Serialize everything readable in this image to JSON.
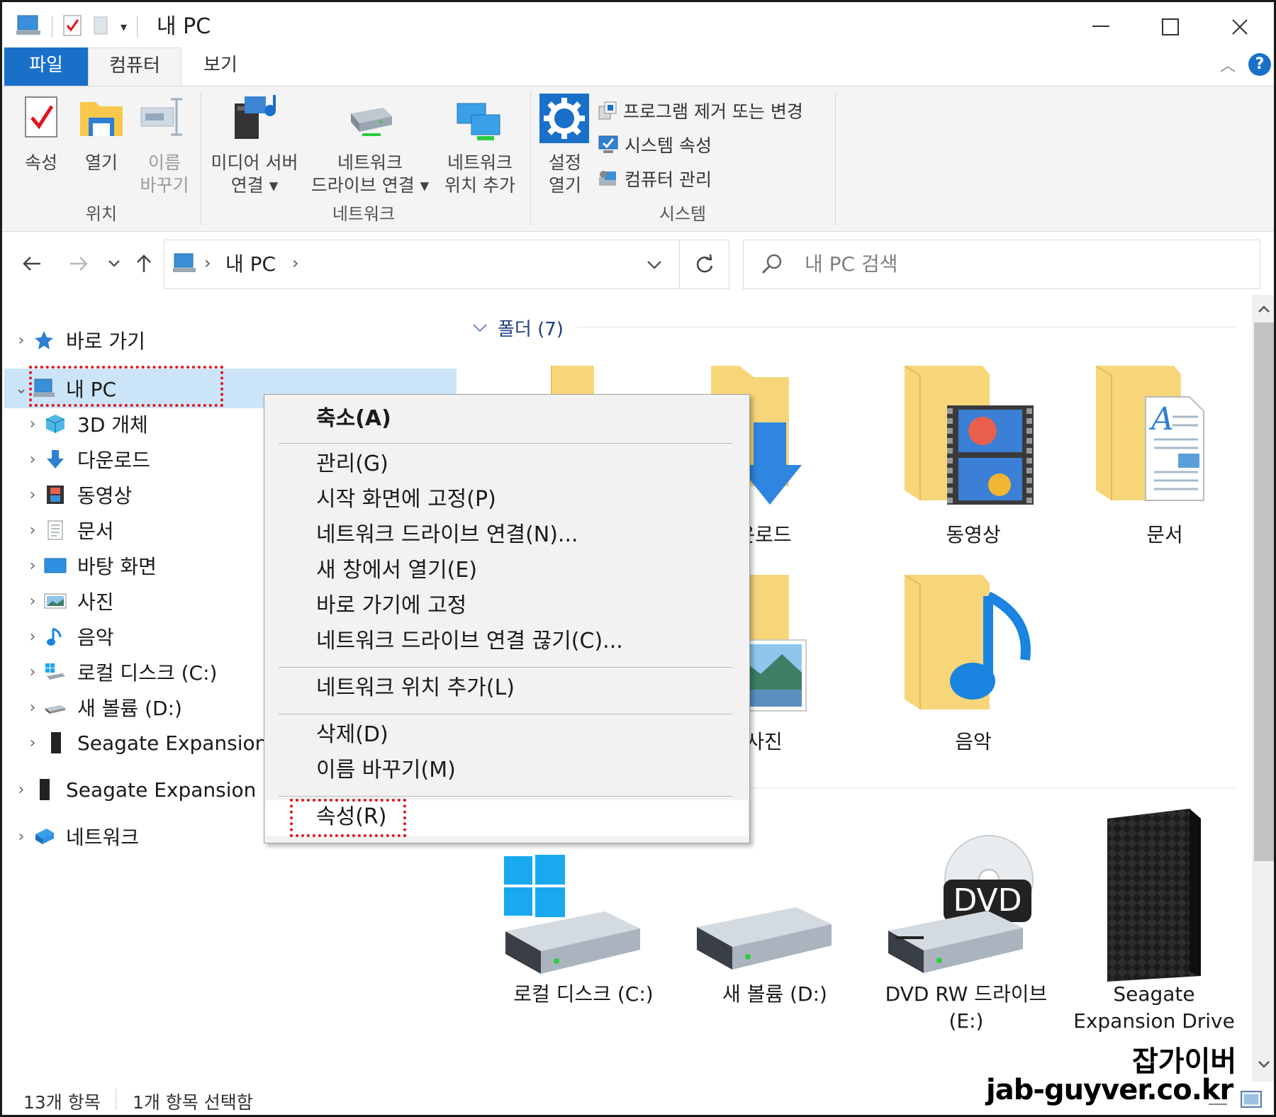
{
  "window": {
    "title": "내 PC"
  },
  "ribbon": {
    "tabs": {
      "file": "파일",
      "computer": "컴퓨터",
      "view": "보기"
    },
    "location": {
      "properties": "속성",
      "open": "열기",
      "rename_line1": "이름",
      "rename_line2": "바꾸기",
      "group": "위치"
    },
    "network": {
      "media_line1": "미디어 서버",
      "media_line2": "연결 ▾",
      "map_line1": "네트워크",
      "map_line2": "드라이브 연결 ▾",
      "add_line1": "네트워크",
      "add_line2": "위치 추가",
      "group": "네트워크"
    },
    "system": {
      "settings_line1": "설정",
      "settings_line2": "열기",
      "uninstall": "프로그램 제거 또는 변경",
      "sysprops": "시스템 속성",
      "manage": "컴퓨터 관리",
      "group": "시스템"
    }
  },
  "address": {
    "path": "내 PC",
    "search_placeholder": "내 PC 검색"
  },
  "navpane": {
    "quick_access": "바로 가기",
    "this_pc": "내 PC",
    "items": [
      "3D 개체",
      "다운로드",
      "동영상",
      "문서",
      "바탕 화면",
      "사진",
      "음악",
      "로컬 디스크 (C:)",
      "새 볼륨 (D:)",
      "Seagate Expansion D"
    ],
    "seagate_root": "Seagate Expansion D",
    "network": "네트워크"
  },
  "content": {
    "folders_header": "폴더 (7)",
    "folders": {
      "downloads": "운로드",
      "videos": "동영상",
      "documents": "문서",
      "pictures": "사진",
      "music": "음악"
    },
    "drives": {
      "c": "로컬 디스크 (C:)",
      "d": "새 볼륨 (D:)",
      "dvd_line1": "DVD RW 드라이브",
      "dvd_line2": "(E:)",
      "dvd_badge": "DVD",
      "seagate_line1": "Seagate",
      "seagate_line2": "Expansion Drive"
    }
  },
  "context_menu": {
    "collapse": "축소(A)",
    "manage": "관리(G)",
    "pin_start": "시작 화면에 고정(P)",
    "map_drive": "네트워크 드라이브 연결(N)...",
    "new_window": "새 창에서 열기(E)",
    "pin_quick": "바로 가기에 고정",
    "disconnect": "네트워크 드라이브 연결 끊기(C)...",
    "add_location": "네트워크 위치 추가(L)",
    "delete": "삭제(D)",
    "rename": "이름 바꾸기(M)",
    "properties": "속성(R)"
  },
  "status": {
    "count": "13개 항목",
    "selected": "1개 항목 선택함"
  },
  "watermark": {
    "line1": "잡가이버",
    "line2": "jab-guyver.co.kr"
  },
  "colors": {
    "accent": "#1a6fc9",
    "highlight": "#cce4f7",
    "annotation": "#e0141e",
    "folder": "#f7d67a"
  }
}
